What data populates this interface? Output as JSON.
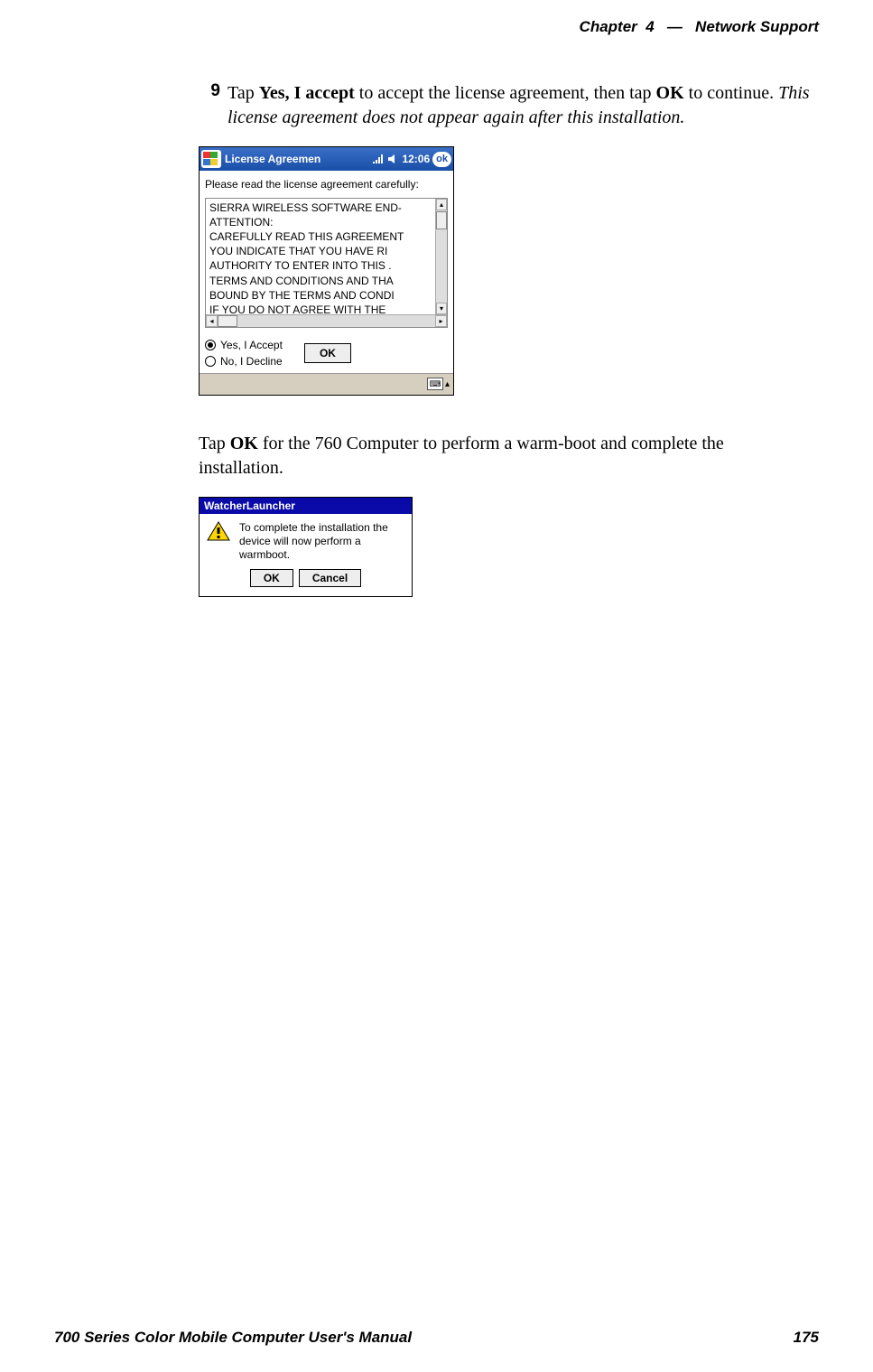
{
  "header": {
    "chapter_label": "Chapter",
    "chapter_number": "4",
    "separator": "—",
    "chapter_title": "Network Support"
  },
  "step": {
    "number": "9",
    "text_parts": {
      "t1": "Tap ",
      "b1": "Yes, I accept",
      "t2": " to accept the license agreement, then tap ",
      "b2": "OK",
      "t3": " to continue. ",
      "i1": "This license agreement does not appear again after this installation."
    }
  },
  "ppc": {
    "title": "License Agreemen",
    "time": "12:06",
    "ok_pill": "ok",
    "lead": "Please read the license agreement carefully:",
    "license_lines": [
      "SIERRA WIRELESS SOFTWARE END-",
      "ATTENTION:",
      "CAREFULLY READ THIS AGREEMENT",
      "YOU  INDICATE THAT YOU HAVE RI",
      "AUTHORITY TO ENTER INTO THIS .",
      "TERMS AND CONDITIONS AND THA",
      "BOUND BY THE TERMS AND CONDI",
      "IF YOU DO NOT AGREE WITH THE "
    ],
    "radio_yes": "Yes, I Accept",
    "radio_no": "No, I Decline",
    "ok_button": "OK"
  },
  "para2": {
    "t1": "Tap ",
    "b1": "OK",
    "t2": " for the 760 Computer to perform a warm-boot and complete the installation."
  },
  "dlg": {
    "title": "WatcherLauncher",
    "message": "To complete the installation the device will now perform a warmboot.",
    "ok": "OK",
    "cancel": "Cancel"
  },
  "footer": {
    "manual_title": "700 Series Color Mobile Computer User's Manual",
    "page_number": "175"
  }
}
